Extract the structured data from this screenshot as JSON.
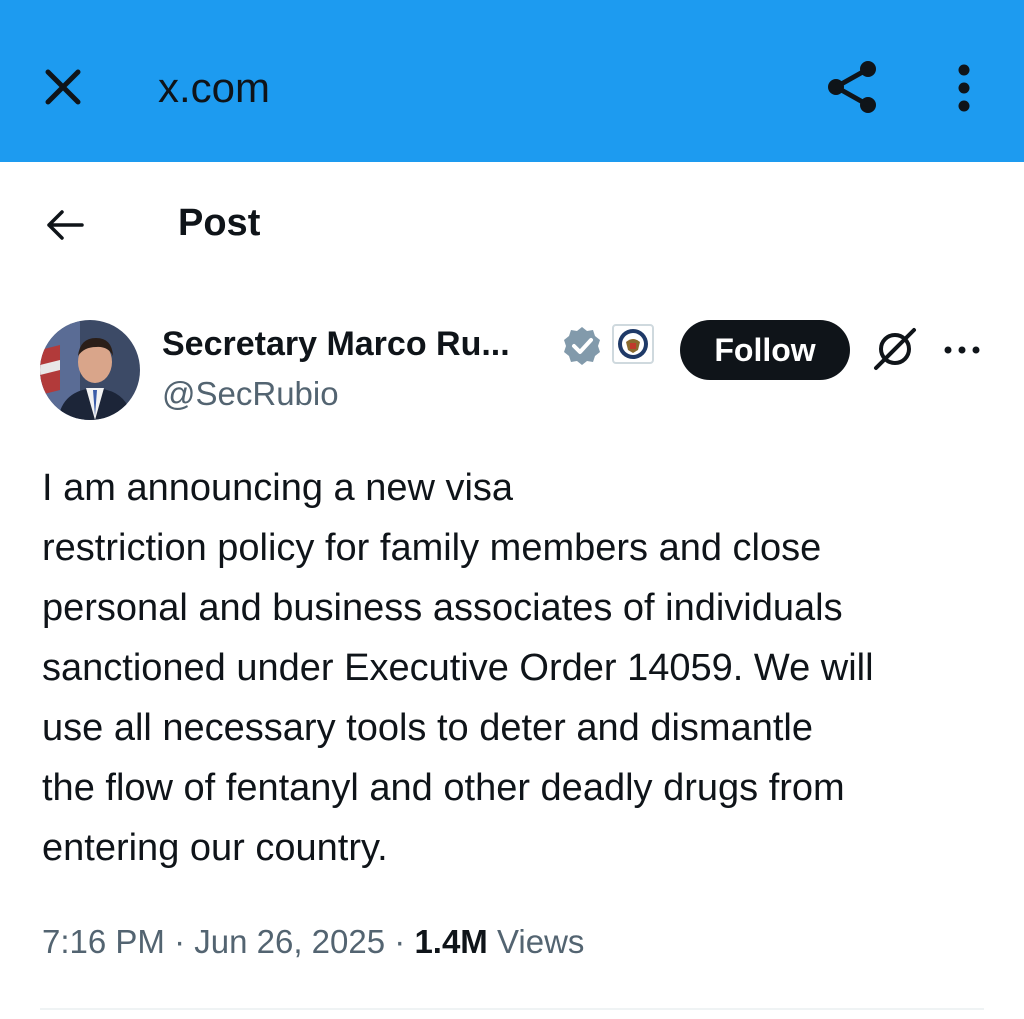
{
  "browser": {
    "domain": "x.com",
    "close_icon": "close-icon",
    "share_icon": "share-icon",
    "menu_icon": "kebab-menu-icon",
    "bar_color": "#1d9bf0"
  },
  "header": {
    "title": "Post",
    "back_icon": "arrow-left-icon"
  },
  "post": {
    "author_name": "Secretary Marco Ru...",
    "author_handle": "@SecRubio",
    "follow_label": "Follow",
    "text_lines": [
      "I am announcing a new visa",
      "restriction policy for family members and close",
      "personal and business associates of individuals",
      "sanctioned under Executive Order 14059. We will",
      "use all necessary tools to deter and dismantle",
      "the flow of fentanyl and other deadly drugs from",
      "entering our country."
    ],
    "time": "7:16 PM",
    "date": "Jun 26, 2025",
    "views_count": "1.4M",
    "views_label": "Views"
  }
}
